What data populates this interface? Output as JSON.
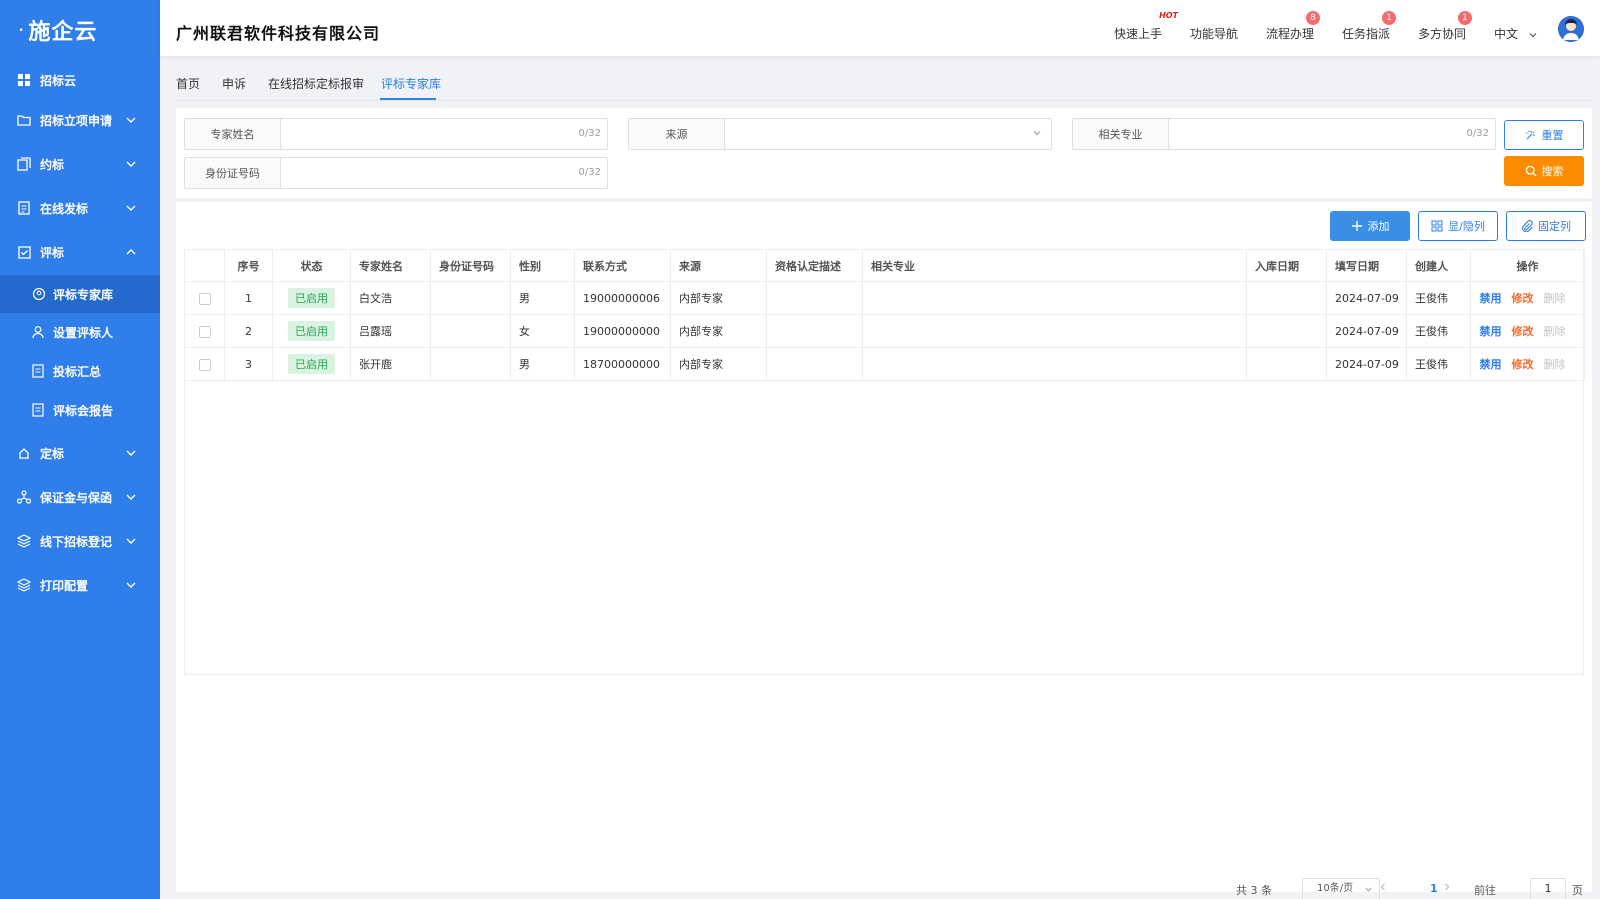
{
  "sidebar": {
    "logo": "施企云",
    "items": [
      {
        "label": "招标云",
        "icon": "grid-icon"
      },
      {
        "label": "招标立项申请",
        "icon": "folder-icon"
      },
      {
        "label": "约标",
        "icon": "stack-icon"
      },
      {
        "label": "在线发标",
        "icon": "document-icon"
      },
      {
        "label": "评标",
        "icon": "clipboard-check-icon"
      },
      {
        "label": "定标",
        "icon": "hand-icon"
      },
      {
        "label": "保证金与保函",
        "icon": "network-icon"
      },
      {
        "label": "线下招标登记",
        "icon": "layers-icon"
      },
      {
        "label": "打印配置",
        "icon": "layers-icon"
      }
    ],
    "sub_items": [
      {
        "label": "评标专家库",
        "icon": "expert-icon"
      },
      {
        "label": "设置评标人",
        "icon": "user-settings-icon"
      },
      {
        "label": "投标汇总",
        "icon": "report-icon"
      },
      {
        "label": "评标会报告",
        "icon": "report-icon"
      }
    ]
  },
  "header": {
    "company": "广州联君软件科技有限公司",
    "nav": [
      {
        "label": "快速上手",
        "badge": "HOT"
      },
      {
        "label": "功能导航",
        "badge": ""
      },
      {
        "label": "流程办理",
        "badge": "8"
      },
      {
        "label": "任务指派",
        "badge": "1"
      },
      {
        "label": "多方协同",
        "badge": "1"
      }
    ],
    "language": "中文"
  },
  "tabs": [
    "首页",
    "申诉",
    "在线招标定标报审",
    "评标专家库"
  ],
  "filters": {
    "expert_name": {
      "label": "专家姓名",
      "count": "0/32"
    },
    "source": {
      "label": "来源"
    },
    "specialty": {
      "label": "相关专业",
      "count": "0/32"
    },
    "id_number": {
      "label": "身份证号码",
      "count": "0/32"
    },
    "reset_label": "重置",
    "search_label": "搜索"
  },
  "toolbar": {
    "add_label": "添加",
    "toggle_columns_label": "显/隐列",
    "fix_columns_label": "固定列"
  },
  "table": {
    "headers": [
      "",
      "序号",
      "状态",
      "专家姓名",
      "身份证号码",
      "性别",
      "联系方式",
      "来源",
      "资格认定描述",
      "相关专业",
      "入库日期",
      "填写日期",
      "创建人",
      "操作"
    ],
    "rows": [
      {
        "index": "1",
        "status": "已启用",
        "name": "白文浩",
        "id": "",
        "gender": "男",
        "phone": "19000000006",
        "source": "内部专家",
        "qualification": "",
        "specialty": "",
        "entry_date": "",
        "fill_date": "2024-07-09",
        "creator": "王俊伟",
        "op_disable": "禁用",
        "op_edit": "修改",
        "op_delete": "删除"
      },
      {
        "index": "2",
        "status": "已启用",
        "name": "吕露瑶",
        "id": "",
        "gender": "女",
        "phone": "19000000000",
        "source": "内部专家",
        "qualification": "",
        "specialty": "",
        "entry_date": "",
        "fill_date": "2024-07-09",
        "creator": "王俊伟",
        "op_disable": "禁用",
        "op_edit": "修改",
        "op_delete": "删除"
      },
      {
        "index": "3",
        "status": "已启用",
        "name": "张开鹿",
        "id": "",
        "gender": "男",
        "phone": "18700000000",
        "source": "内部专家",
        "qualification": "",
        "specialty": "",
        "entry_date": "",
        "fill_date": "2024-07-09",
        "creator": "王俊伟",
        "op_disable": "禁用",
        "op_edit": "修改",
        "op_delete": "删除"
      }
    ]
  },
  "pagination": {
    "total": "共 3 条",
    "page_size": "10条/页",
    "current_page": "1",
    "goto_label": "前往",
    "goto_value": "1",
    "page_suffix": "页"
  },
  "colors": {
    "sidebar": "#2f7ee9",
    "primary": "#2f7ee9",
    "search_button": "#fb8c00",
    "edit_action": "#f56c2c",
    "status_enabled": "#27a654"
  }
}
